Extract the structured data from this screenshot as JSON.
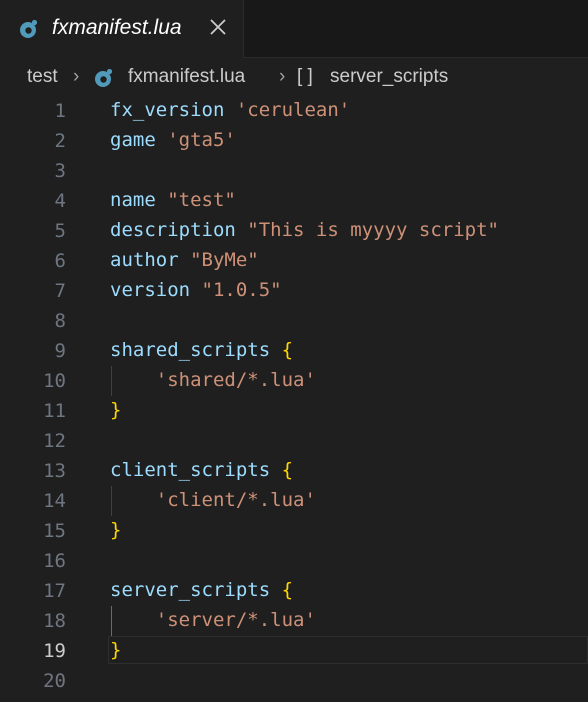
{
  "tab": {
    "title": "fxmanifest.lua",
    "icon": "lua-file-icon",
    "close_icon": "close-icon"
  },
  "breadcrumb": {
    "folder": "test",
    "file": "fxmanifest.lua",
    "symbol_icon": "[ ]",
    "symbol": "server_scripts"
  },
  "editor": {
    "active_line": 19,
    "lines": [
      {
        "n": "1",
        "tokens": [
          [
            "id",
            "fx_version"
          ],
          [
            "plain",
            " "
          ],
          [
            "str",
            "'cerulean'"
          ]
        ]
      },
      {
        "n": "2",
        "tokens": [
          [
            "id",
            "game"
          ],
          [
            "plain",
            " "
          ],
          [
            "str",
            "'gta5'"
          ]
        ]
      },
      {
        "n": "3",
        "tokens": []
      },
      {
        "n": "4",
        "tokens": [
          [
            "id",
            "name"
          ],
          [
            "plain",
            " "
          ],
          [
            "str",
            "\"test\""
          ]
        ]
      },
      {
        "n": "5",
        "tokens": [
          [
            "id",
            "description"
          ],
          [
            "plain",
            " "
          ],
          [
            "str",
            "\"This is myyyy script\""
          ]
        ]
      },
      {
        "n": "6",
        "tokens": [
          [
            "id",
            "author"
          ],
          [
            "plain",
            " "
          ],
          [
            "str",
            "\"ByMe\""
          ]
        ]
      },
      {
        "n": "7",
        "tokens": [
          [
            "id",
            "version"
          ],
          [
            "plain",
            " "
          ],
          [
            "str",
            "\"1.0.5\""
          ]
        ]
      },
      {
        "n": "8",
        "tokens": []
      },
      {
        "n": "9",
        "tokens": [
          [
            "id",
            "shared_scripts"
          ],
          [
            "plain",
            " "
          ],
          [
            "br",
            "{"
          ]
        ]
      },
      {
        "n": "10",
        "tokens": [
          [
            "plain",
            "    "
          ],
          [
            "str",
            "'shared/*.lua'"
          ]
        ]
      },
      {
        "n": "11",
        "tokens": [
          [
            "br",
            "}"
          ]
        ]
      },
      {
        "n": "12",
        "tokens": []
      },
      {
        "n": "13",
        "tokens": [
          [
            "id",
            "client_scripts"
          ],
          [
            "plain",
            " "
          ],
          [
            "br",
            "{"
          ]
        ]
      },
      {
        "n": "14",
        "tokens": [
          [
            "plain",
            "    "
          ],
          [
            "str",
            "'client/*.lua'"
          ]
        ]
      },
      {
        "n": "15",
        "tokens": [
          [
            "br",
            "}"
          ]
        ]
      },
      {
        "n": "16",
        "tokens": []
      },
      {
        "n": "17",
        "tokens": [
          [
            "id",
            "server_scripts"
          ],
          [
            "plain",
            " "
          ],
          [
            "br",
            "{"
          ]
        ]
      },
      {
        "n": "18",
        "tokens": [
          [
            "plain",
            "    "
          ],
          [
            "str",
            "'server/*.lua'"
          ]
        ]
      },
      {
        "n": "19",
        "tokens": [
          [
            "br",
            "}"
          ]
        ]
      },
      {
        "n": "20",
        "tokens": []
      }
    ]
  },
  "colors": {
    "background": "#1f1f1f",
    "identifier": "#9cdcfe",
    "string": "#ce9178",
    "bracket": "#ffd700",
    "line_number": "#6e7681",
    "lua_icon": "#519aba"
  }
}
